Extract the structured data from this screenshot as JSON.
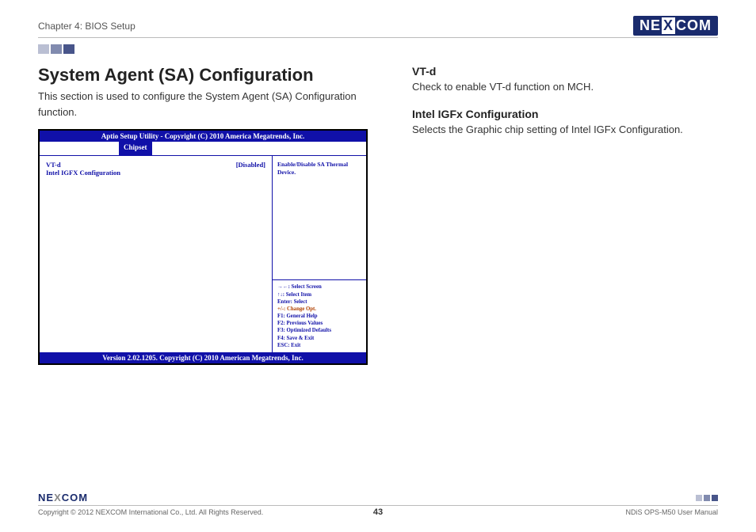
{
  "header": {
    "chapter": "Chapter 4: BIOS Setup",
    "logo_text_a": "NE",
    "logo_text_x": "X",
    "logo_text_b": "COM"
  },
  "left_col": {
    "title": "System Agent (SA) Configuration",
    "description": "This section is used to configure the System Agent (SA) Configuration function."
  },
  "right_col": {
    "s1_head": "VT-d",
    "s1_body": "Check to enable VT-d function on MCH.",
    "s2_head": "Intel IGFx Configuration",
    "s2_body": "Selects the Graphic chip setting of Intel IGFx Configuration."
  },
  "bios": {
    "top_bar": "Aptio Setup Utility - Copyright (C) 2010 America Megatrends, Inc.",
    "tab_active": "Chipset",
    "items": [
      {
        "label": "VT-d",
        "value": "[Disabled]"
      },
      {
        "label": "Intel IGFX Configuration",
        "value": ""
      }
    ],
    "help_text": "Enable/Disable SA Thermal Device.",
    "keys": {
      "l1": "→←: Select Screen",
      "l2": "↑↓: Select Item",
      "l3": "Enter: Select",
      "l4": "+/-: Change Opt.",
      "l5": "F1: General Help",
      "l6": "F2: Previous Values",
      "l7": "F3: Optimized Defaults",
      "l8": "F4: Save & Exit",
      "l9": "ESC: Exit"
    },
    "bottom_bar": "Version 2.02.1205. Copyright (C) 2010 American Megatrends, Inc."
  },
  "footer": {
    "logo_a": "NE",
    "logo_x": "X",
    "logo_b": "COM",
    "copyright": "Copyright © 2012 NEXCOM International Co., Ltd. All Rights Reserved.",
    "page_number": "43",
    "manual": "NDiS OPS-M50 User Manual"
  }
}
